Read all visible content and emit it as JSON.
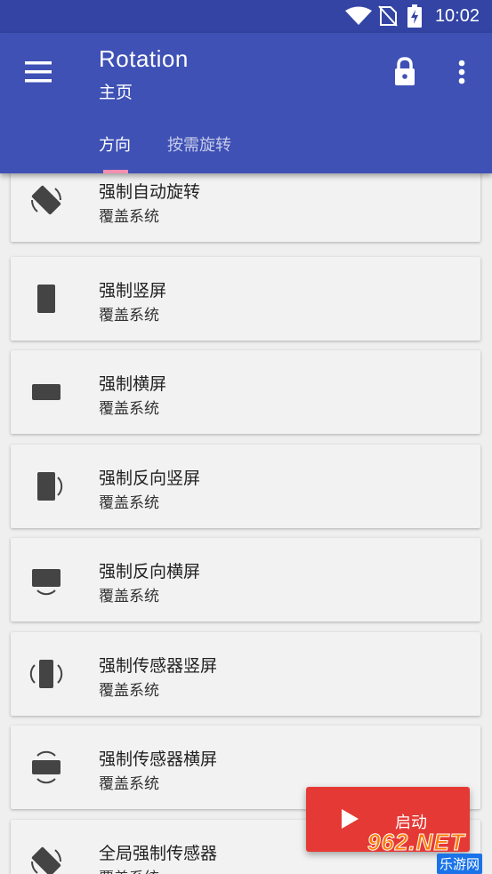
{
  "status_bar": {
    "time": "10:02"
  },
  "app_bar": {
    "title": "Rotation",
    "subtitle": "主页",
    "tabs": [
      {
        "label": "方向",
        "active": true
      },
      {
        "label": "按需旋转",
        "active": false
      }
    ]
  },
  "items": [
    {
      "name": "强制自动旋转",
      "desc": "覆盖系统",
      "icon": "auto-rotate-icon"
    },
    {
      "name": "强制竖屏",
      "desc": "覆盖系统",
      "icon": "portrait-icon"
    },
    {
      "name": "强制横屏",
      "desc": "覆盖系统",
      "icon": "landscape-icon"
    },
    {
      "name": "强制反向竖屏",
      "desc": "覆盖系统",
      "icon": "reverse-portrait-icon"
    },
    {
      "name": "强制反向横屏",
      "desc": "覆盖系统",
      "icon": "reverse-landscape-icon"
    },
    {
      "name": "强制传感器竖屏",
      "desc": "覆盖系统",
      "icon": "sensor-portrait-icon"
    },
    {
      "name": "强制传感器横屏",
      "desc": "覆盖系统",
      "icon": "sensor-landscape-icon"
    },
    {
      "name": "全局强制传感器",
      "desc": "覆盖系统",
      "icon": "full-sensor-icon"
    }
  ],
  "fab": {
    "label": "启动"
  },
  "watermark": {
    "number": "962.NET",
    "site": "乐游网"
  },
  "colors": {
    "primary": "#3f51b5",
    "status_bar": "#3344a4",
    "accent": "#f48fb1",
    "fab": "#e53935"
  }
}
